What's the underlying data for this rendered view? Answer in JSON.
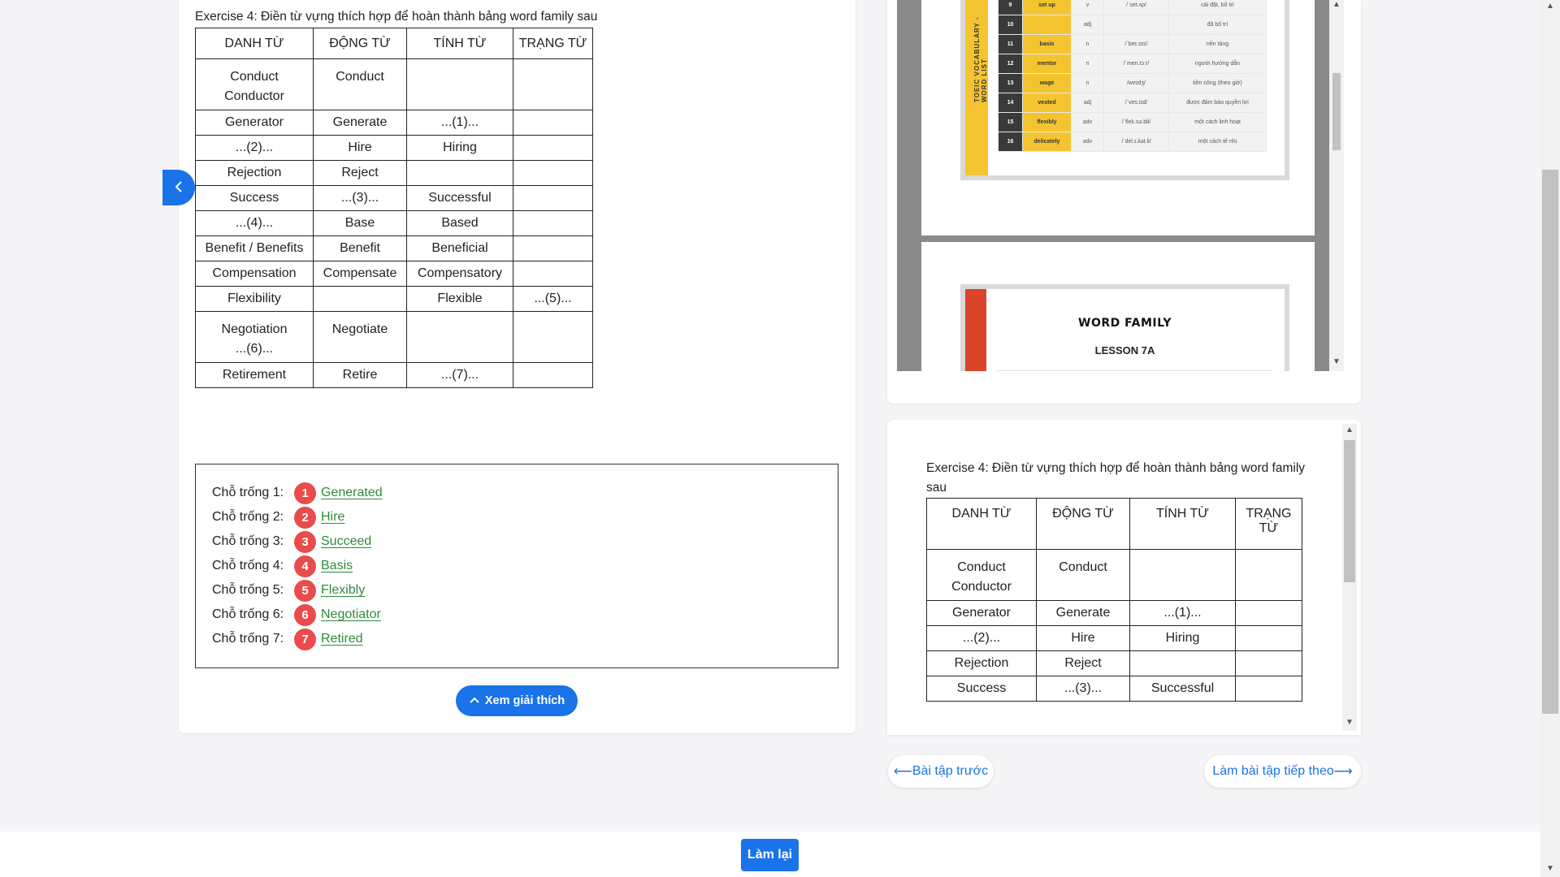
{
  "exercise": {
    "title": "Exercise 4: Điền từ vựng thích hợp để hoàn thành bảng word family sau",
    "headers": [
      "DANH TỪ",
      "ĐỘNG TỪ",
      "TÍNH TỪ",
      "TRẠNG TỪ"
    ],
    "rows": [
      [
        "Conduct\nConductor",
        "Conduct",
        "",
        ""
      ],
      [
        "Generator",
        "Generate",
        "...(1)...",
        ""
      ],
      [
        "...(2)...",
        "Hire",
        "Hiring",
        ""
      ],
      [
        "Rejection",
        "Reject",
        "",
        ""
      ],
      [
        "Success",
        "...(3)...",
        "Successful",
        ""
      ],
      [
        "...(4)...",
        "Base",
        "Based",
        ""
      ],
      [
        "Benefit / Benefits",
        "Benefit",
        "Beneficial",
        ""
      ],
      [
        "Compensation",
        "Compensate",
        "Compensatory",
        ""
      ],
      [
        "Flexibility",
        "",
        "Flexible",
        "...(5)..."
      ],
      [
        "Negotiation\n...(6)...",
        "Negotiate",
        "",
        ""
      ],
      [
        "Retirement",
        "Retire",
        "...(7)...",
        ""
      ]
    ]
  },
  "answers": [
    {
      "label": "Chỗ trống 1:",
      "num": "1",
      "value": "Generated"
    },
    {
      "label": "Chỗ trống 2:",
      "num": "2",
      "value": "Hire"
    },
    {
      "label": "Chỗ trống 3:",
      "num": "3",
      "value": "Succeed"
    },
    {
      "label": "Chỗ trống 4:",
      "num": "4",
      "value": "Basis"
    },
    {
      "label": "Chỗ trống 5:",
      "num": "5",
      "value": "Flexibly"
    },
    {
      "label": "Chỗ trống 6:",
      "num": "6",
      "value": "Negotiator"
    },
    {
      "label": "Chỗ trống 7:",
      "num": "7",
      "value": "Retired"
    }
  ],
  "buttons": {
    "explain": "Xem giải thích",
    "prev": "Bài tập trước",
    "next": "Làm bài tập tiếp theo",
    "redo": "Làm lại"
  },
  "doc": {
    "vertical_label": "TOEIC VOCABULARY - WORD LIST",
    "vocab": [
      {
        "n": "9",
        "word": "set up",
        "pos": "v",
        "phon": "/ˈset.ʌp/",
        "mean": "cài đặt, bố trí"
      },
      {
        "n": "10",
        "word": "",
        "pos": "adj",
        "phon": "",
        "mean": "đã bố trí"
      },
      {
        "n": "11",
        "word": "basis",
        "pos": "n",
        "phon": "/ˈbeɪ.sɪs/",
        "mean": "nền tảng"
      },
      {
        "n": "12",
        "word": "mentor",
        "pos": "n",
        "phon": "/ˈmen.tɔːr/",
        "mean": "người hướng dẫn"
      },
      {
        "n": "13",
        "word": "wage",
        "pos": "n",
        "phon": "/weɪdʒ/",
        "mean": "tiền công (theo giờ)"
      },
      {
        "n": "14",
        "word": "vested",
        "pos": "adj",
        "phon": "/ˈves.tɪd/",
        "mean": "được đảm bảo quyền lợi"
      },
      {
        "n": "15",
        "word": "flexibly",
        "pos": "adv",
        "phon": "/ˈflek.sə.bli/",
        "mean": "một cách linh hoạt"
      },
      {
        "n": "16",
        "word": "delicately",
        "pos": "adv",
        "phon": "/ˈdel.ɪ.kət.li/",
        "mean": "một cách tế nhị"
      }
    ],
    "wf_title": "WORD FAMILY",
    "wf_sub": "LESSON 7A"
  },
  "mini": {
    "title": "Exercise 4: Điền từ vựng thích hợp để hoàn thành bảng word family sau",
    "headers": [
      "DANH TỪ",
      "ĐỘNG TỪ",
      "TÍNH TỪ",
      "TRẠNG\nTỪ"
    ],
    "rows": [
      [
        "Conduct\nConductor",
        "Conduct",
        "",
        ""
      ],
      [
        "Generator",
        "Generate",
        "...(1)...",
        ""
      ],
      [
        "...(2)...",
        "Hire",
        "Hiring",
        ""
      ],
      [
        "Rejection",
        "Reject",
        "",
        ""
      ],
      [
        "Success",
        "...(3)...",
        "Successful",
        ""
      ]
    ]
  },
  "colors": {
    "accent": "#1a73e8",
    "badge": "#ea4b4b",
    "answer": "#2e8b3a",
    "doc_yellow": "#f4c430",
    "doc_red": "#d9442a"
  },
  "icons": {
    "side_tab": "chevron-left-icon",
    "explain": "chevron-up-icon",
    "prev": "arrow-left-icon",
    "next": "arrow-right-icon"
  }
}
